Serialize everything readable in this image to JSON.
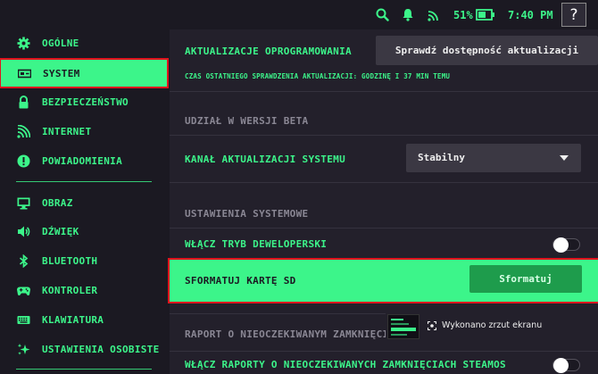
{
  "status": {
    "battery_percent": "51%",
    "time": "7:40 PM",
    "help_label": "?",
    "icons": [
      "search-icon",
      "bell-icon",
      "wifi-icon",
      "battery-icon"
    ]
  },
  "sidebar": {
    "items": [
      {
        "label": "OGÓLNE",
        "icon": "gear-icon"
      },
      {
        "label": "SYSTEM",
        "icon": "system-icon"
      },
      {
        "label": "BEZPIECZEŃSTWO",
        "icon": "lock-icon"
      },
      {
        "label": "INTERNET",
        "icon": "wifi-icon"
      },
      {
        "label": "POWIADOMIENIA",
        "icon": "alert-icon"
      },
      {
        "label": "OBRAZ",
        "icon": "monitor-icon"
      },
      {
        "label": "DŹWIĘK",
        "icon": "speaker-icon"
      },
      {
        "label": "BLUETOOTH",
        "icon": "bluetooth-icon"
      },
      {
        "label": "KONTROLER",
        "icon": "gamepad-icon"
      },
      {
        "label": "KLAWIATURA",
        "icon": "keyboard-icon"
      },
      {
        "label": "USTAWIENIA OSOBISTE",
        "icon": "sparkle-icon"
      }
    ]
  },
  "main": {
    "updates_label": "AKTUALIZACJE OPROGRAMOWANIA",
    "check_button": "Sprawdź dostępność aktualizacji",
    "last_check": "CZAS OSTATNIEGO SPRAWDZENIA AKTUALIZACJI: GODZINĘ I 37 MIN TEMU",
    "beta_header": "UDZIAŁ W WERSJI BETA",
    "channel_label": "KANAŁ AKTUALIZACJI SYSTEMU",
    "channel_value": "Stabilny",
    "system_header": "USTAWIENIA SYSTEMOWE",
    "dev_mode_label": "WŁĄCZ TRYB DEWELOPERSKI",
    "dev_mode_on": false,
    "format_label": "SFORMATUJ KARTĘ SD",
    "format_button": "Sformatuj",
    "crash_header": "RAPORT O NIEOCZEKIWANYM ZAMKNIĘCIU",
    "crash_toggle_label": "WŁĄCZ RAPORTY O NIEOCZEKIWANYCH ZAMKNIĘCIACH STEAMOS",
    "crash_toggle_on": false
  },
  "toast": {
    "message": "Wykonano zrzut ekranu",
    "icon": "screenshot-icon"
  },
  "colors": {
    "accent": "#3cf58a",
    "background": "#23202b",
    "sidebar": "#1b1922",
    "highlight_border": "#e0141e"
  }
}
